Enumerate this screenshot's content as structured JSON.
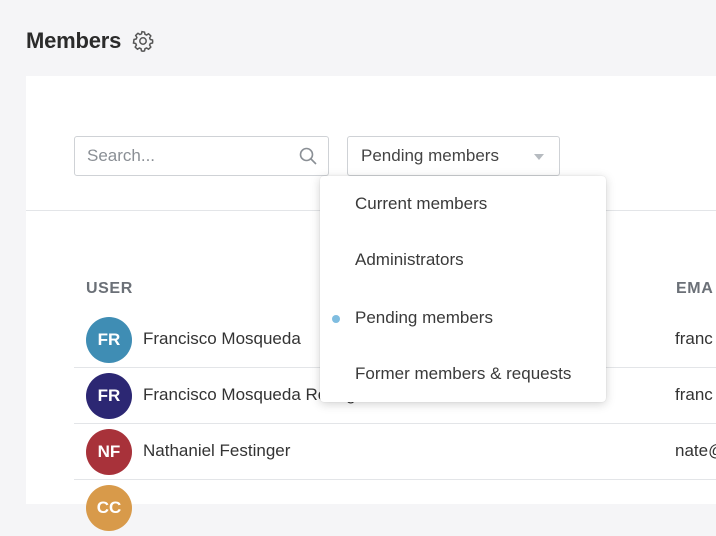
{
  "header": {
    "title": "Members",
    "settings_icon": "gear-icon"
  },
  "search": {
    "placeholder": "Search...",
    "value": "",
    "icon": "search-icon"
  },
  "filter": {
    "selected": "Pending members",
    "options": [
      "Current members",
      "Administrators",
      "Pending members",
      "Former members & requests"
    ],
    "selected_index": 2
  },
  "table": {
    "columns": {
      "user": "USER",
      "email": "EMA"
    },
    "rows": [
      {
        "initials": "FR",
        "name": "Francisco Mosqueda",
        "email": "franc",
        "avatar_color": "#3f8db4"
      },
      {
        "initials": "FR",
        "name": "Francisco Mosqueda Rodriguez",
        "email": "franc",
        "avatar_color": "#2c2773"
      },
      {
        "initials": "NF",
        "name": "Nathaniel Festinger",
        "email": "nate@",
        "avatar_color": "#a8323a"
      },
      {
        "initials": "CC",
        "name": "",
        "email": "",
        "avatar_color": "#d89a4a"
      }
    ]
  },
  "colors": {
    "accent_dot": "#7fbde0",
    "background": "#f5f5f7"
  }
}
